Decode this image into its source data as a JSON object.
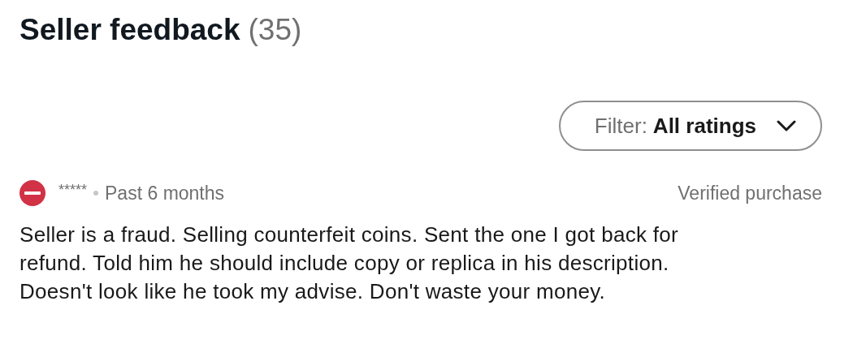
{
  "header": {
    "title": "Seller feedback",
    "count": "(35)"
  },
  "filter": {
    "label": "Filter:",
    "value": "All ratings"
  },
  "reviews": [
    {
      "kind": "negative",
      "user": "*****",
      "time": "Past 6 months",
      "verified": "Verified purchase",
      "text": "Seller is a fraud. Selling counterfeit coins. Sent the one I got back for refund. Told him he should include copy or replica in his description. Doesn't look like he took my advise. Don't waste your money."
    }
  ]
}
